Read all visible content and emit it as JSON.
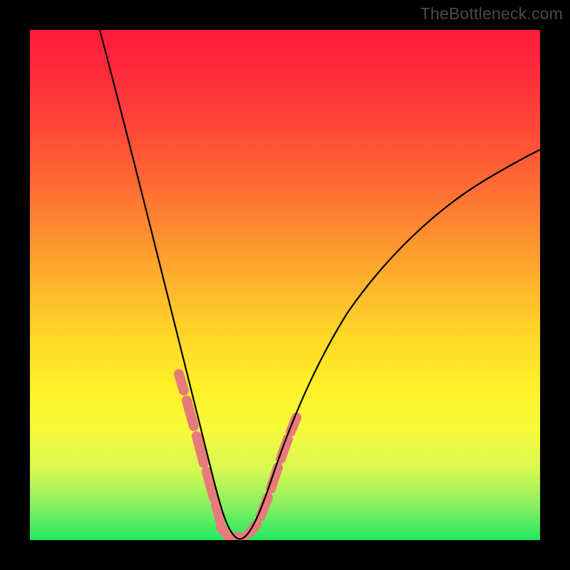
{
  "watermark": "TheBottleneck.com",
  "chart_data": {
    "type": "line",
    "title": "",
    "xlabel": "",
    "ylabel": "",
    "xlim": [
      0,
      100
    ],
    "ylim": [
      0,
      100
    ],
    "grid": false,
    "legend": "none",
    "series": [
      {
        "name": "bottleneck-curve",
        "x": [
          14,
          18,
          22,
          26,
          30,
          32,
          34,
          36,
          37,
          38,
          39,
          40,
          42,
          44,
          46,
          48,
          52,
          56,
          62,
          70,
          80,
          90,
          100
        ],
        "y": [
          100,
          84,
          68,
          52,
          34,
          26,
          18,
          10,
          6,
          3,
          1,
          0,
          1,
          3,
          7,
          12,
          21,
          30,
          40,
          51,
          61,
          69,
          75
        ]
      }
    ],
    "highlight_segments": [
      {
        "name": "left-band",
        "x_start": 30,
        "x_end": 37
      },
      {
        "name": "right-band",
        "x_start": 42,
        "x_end": 50
      }
    ],
    "background_gradient": {
      "stops": [
        {
          "pos": 0.0,
          "color": "#ff1a3e"
        },
        {
          "pos": 0.5,
          "color": "#ffb42c"
        },
        {
          "pos": 0.78,
          "color": "#f8fa3a"
        },
        {
          "pos": 1.0,
          "color": "#20e860"
        }
      ]
    }
  }
}
